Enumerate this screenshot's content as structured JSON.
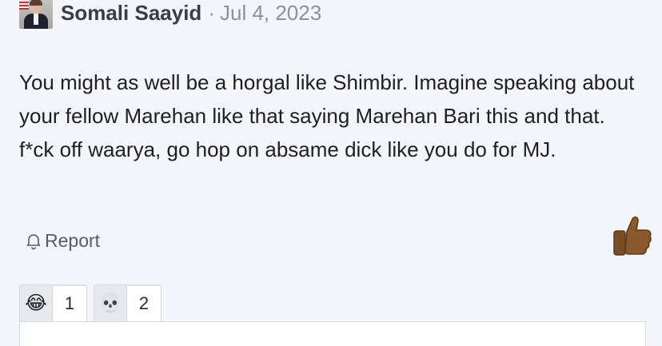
{
  "post": {
    "author": "Somali Saayid",
    "separator": "·",
    "date": "Jul 4, 2023",
    "body": [
      "You might as well be a horgal like Shimbir. Imagine speaking about your fellow Marehan like that saying Marehan Bari this and that. f*ck off waarya, go hop on absame dick like you do for MJ."
    ]
  },
  "actions": {
    "report_label": "Report",
    "like_icon": "thumbs-up-icon"
  },
  "reactions": [
    {
      "emoji": "😂",
      "icon": "laughing-tears-emoji-icon",
      "count": "1"
    },
    {
      "emoji": "💀",
      "icon": "skull-emoji-icon",
      "count": "2"
    }
  ]
}
